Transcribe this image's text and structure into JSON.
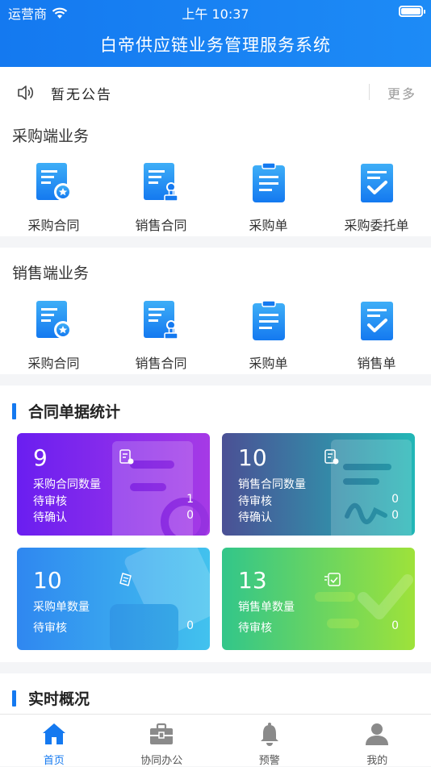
{
  "status_bar": {
    "carrier": "运营商",
    "time": "上午 10:37"
  },
  "header": {
    "title": "白帝供应链业务管理服务系统"
  },
  "notice": {
    "text": "暂无公告",
    "more": "更多"
  },
  "purchase_section": {
    "title": "采购端业务",
    "items": [
      {
        "label": "采购合同",
        "icon": "contract-star-icon"
      },
      {
        "label": "销售合同",
        "icon": "contract-stamp-icon"
      },
      {
        "label": "采购单",
        "icon": "clipboard-list-icon"
      },
      {
        "label": "采购委托单",
        "icon": "clipboard-check-icon"
      }
    ]
  },
  "sales_section": {
    "title": "销售端业务",
    "items": [
      {
        "label": "采购合同",
        "icon": "contract-star-icon"
      },
      {
        "label": "销售合同",
        "icon": "contract-stamp-icon"
      },
      {
        "label": "采购单",
        "icon": "clipboard-list-icon"
      },
      {
        "label": "销售单",
        "icon": "clipboard-check-icon"
      }
    ]
  },
  "stats": {
    "title": "合同单据统计",
    "cards": [
      {
        "count": "9",
        "label": "采购合同数量",
        "rows": [
          {
            "label": "待审核",
            "value": "1"
          },
          {
            "label": "待确认",
            "value": "0"
          }
        ],
        "gradient": [
          "#6a1ef0",
          "#a63ae6"
        ]
      },
      {
        "count": "10",
        "label": "销售合同数量",
        "rows": [
          {
            "label": "待审核",
            "value": "0"
          },
          {
            "label": "待确认",
            "value": "0"
          }
        ],
        "gradient": [
          "#4b5095",
          "#22b7b6"
        ]
      },
      {
        "count": "10",
        "label": "采购单数量",
        "rows": [
          {
            "label": "待审核",
            "value": "0"
          }
        ],
        "gradient": [
          "#2f87f0",
          "#42c2ee"
        ]
      },
      {
        "count": "13",
        "label": "销售单数量",
        "rows": [
          {
            "label": "待审核",
            "value": "0"
          }
        ],
        "gradient": [
          "#32c68a",
          "#9ee23a"
        ]
      }
    ]
  },
  "realtime": {
    "title": "实时概况"
  },
  "tabbar": [
    {
      "label": "首页",
      "icon": "home-icon",
      "active": true
    },
    {
      "label": "协同办公",
      "icon": "briefcase-icon",
      "active": false
    },
    {
      "label": "预警",
      "icon": "bell-icon",
      "active": false
    },
    {
      "label": "我的",
      "icon": "user-icon",
      "active": false
    }
  ],
  "colors": {
    "primary": "#1479f0",
    "icon_gradient_top": "#35a7f5",
    "icon_gradient_bottom": "#1479f0"
  }
}
